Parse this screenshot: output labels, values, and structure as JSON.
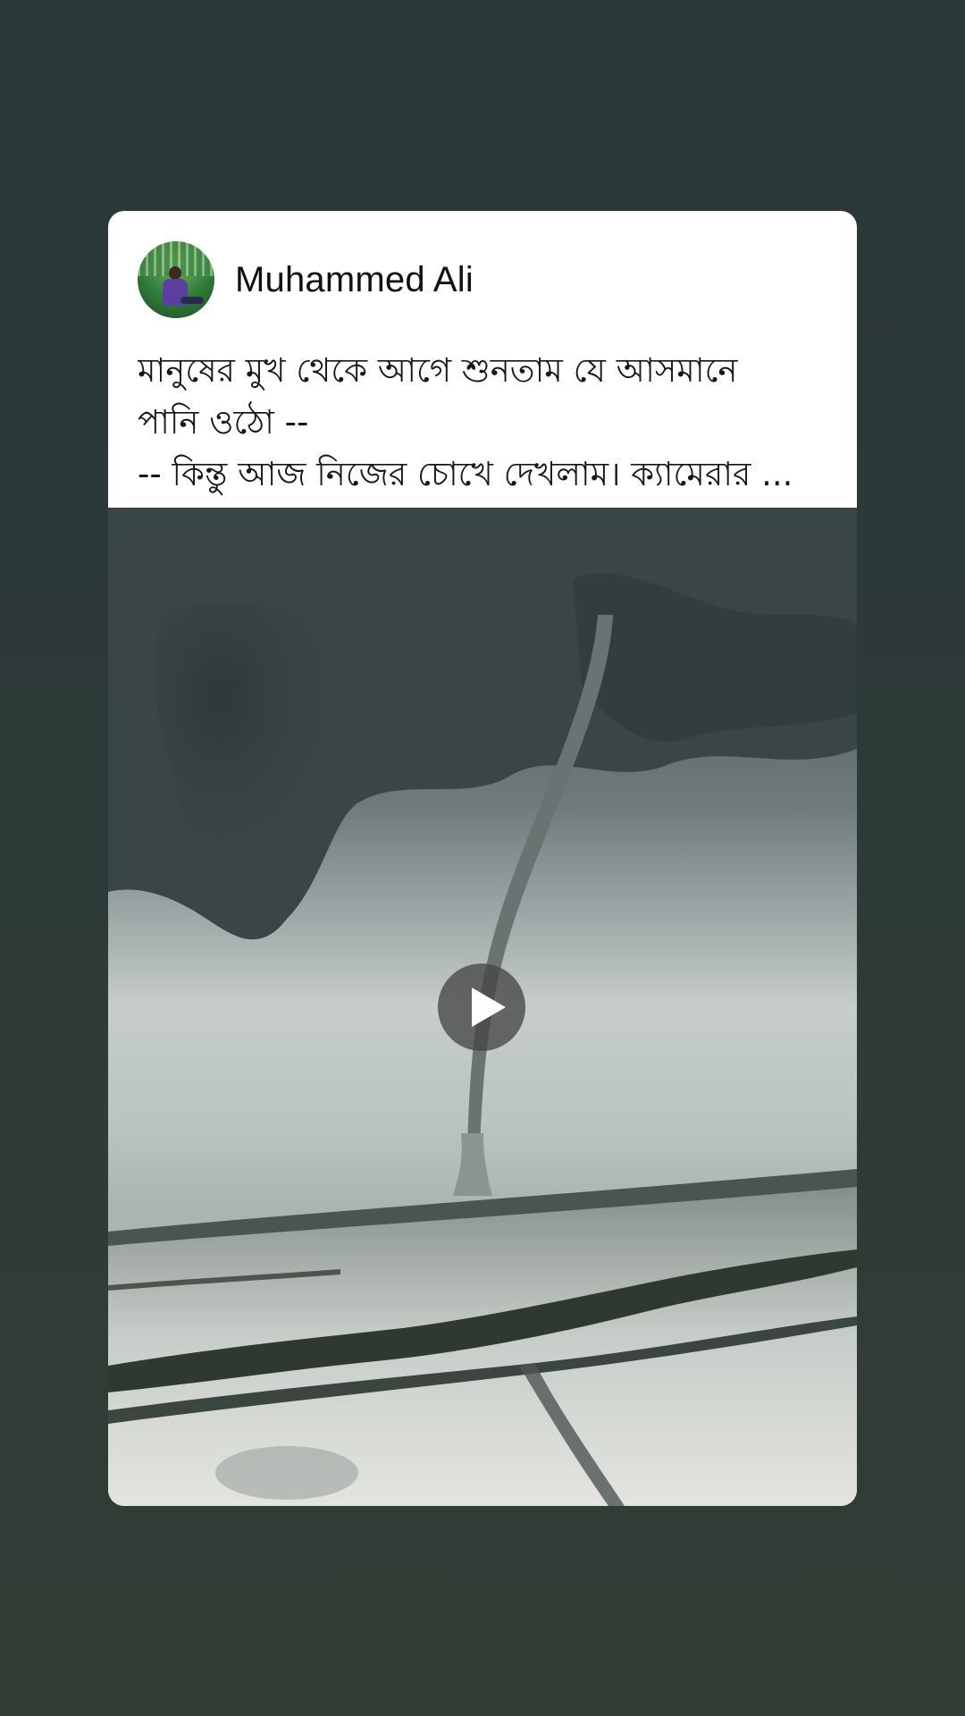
{
  "post": {
    "author": "Muhammed Ali",
    "avatar_icon": "profile-photo-icon",
    "text_lines": [
      "মানুষের মুখ থেকে আগে শুনতাম যে আসমানে",
      "পানি ওঠো --",
      "-- কিন্তু আজ নিজের চোখে  দেখলাম। ক্যামেরার ..."
    ],
    "media": {
      "type": "video",
      "play_icon": "play-icon"
    }
  },
  "colors": {
    "background_top": "#2a3737",
    "background_bottom": "#343d35",
    "card": "#ffffff",
    "text": "#161616"
  }
}
